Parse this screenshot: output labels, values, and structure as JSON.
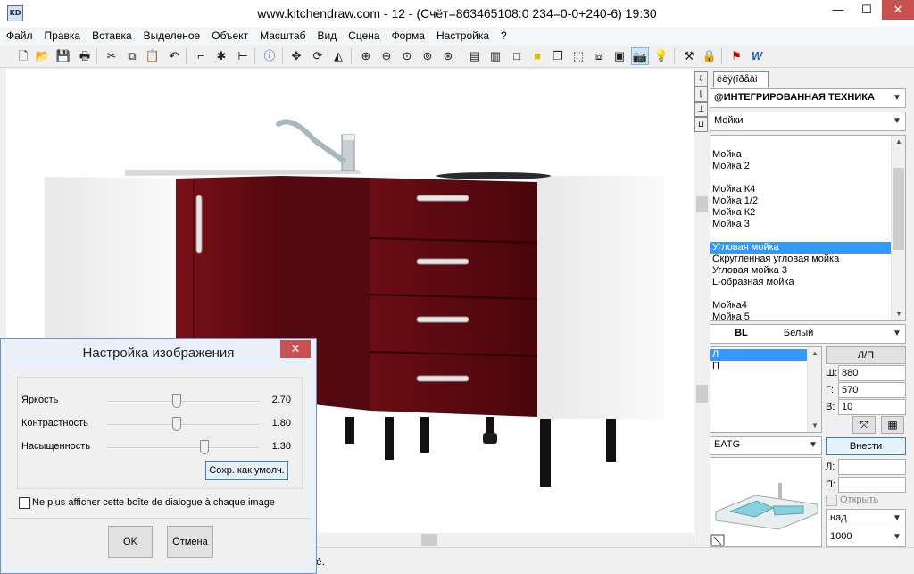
{
  "window": {
    "title": "www.kitchendraw.com - 12 - (Счёт=863465108:0 234=0-0+240-6) 19:30",
    "app_icon": "KD",
    "minimize": "—",
    "maximize": "☐",
    "close": "✕"
  },
  "menu": [
    "Файл",
    "Правка",
    "Вставка",
    "Выделеное",
    "Объект",
    "Масштаб",
    "Вид",
    "Сцена",
    "Форма",
    "Настройка",
    "?"
  ],
  "right_panel": {
    "tab_label": "ëèÿ(îðåäì",
    "category": "@ИНТЕГРИРОВАННАЯ ТЕХНИКА",
    "subcategory": "Мойки",
    "catalog_items": [
      "",
      "Мойка",
      "Мойка 2",
      "",
      "Мойка К4",
      "Мойка 1/2",
      "Мойка К2",
      "Мойка 3",
      "",
      "Угловая мойка",
      "Округленная угловая мойка",
      "Угловая мойка 3",
      "L-образная мойка",
      "",
      "Мойка4",
      "Мойка 5"
    ],
    "selected_item": "Угловая мойка",
    "finish_code": "BL",
    "finish_name": "Белый",
    "orientation_items": [
      "Л",
      "П"
    ],
    "selected_orientation": "Л",
    "lp_button": "Л/П",
    "width_label": "Ш:",
    "width_value": "880",
    "depth_label": "Г:",
    "depth_value": "570",
    "height_label": "В:",
    "height_value": "10",
    "code_combo": "EATG",
    "insert_button": "Внести",
    "left_label": "Л:",
    "right_label": "П:",
    "open_label": "Открыть",
    "position_combo": "над",
    "elevation_combo": "1000"
  },
  "status": {
    "text": "é."
  },
  "dialog": {
    "title": "Настройка изображения",
    "close": "✕",
    "sliders": [
      {
        "label": "Яркость",
        "value": "2.70",
        "level": 0.46
      },
      {
        "label": "Контрастность",
        "value": "1.80",
        "level": 0.46
      },
      {
        "label": "Насыщенность",
        "value": "1.30",
        "level": 0.64
      }
    ],
    "save_default": "Сохр. как умолч.",
    "checkbox_label": "Ne plus afficher cette boîte de dialogue à chaque image",
    "checkbox_checked": false,
    "ok": "OK",
    "cancel": "Отмена"
  },
  "colors": {
    "cabinet_front": "#5e0a10",
    "cabinet_body": "#f2f2f2",
    "selection": "#3399ff",
    "close_red": "#c75050"
  }
}
